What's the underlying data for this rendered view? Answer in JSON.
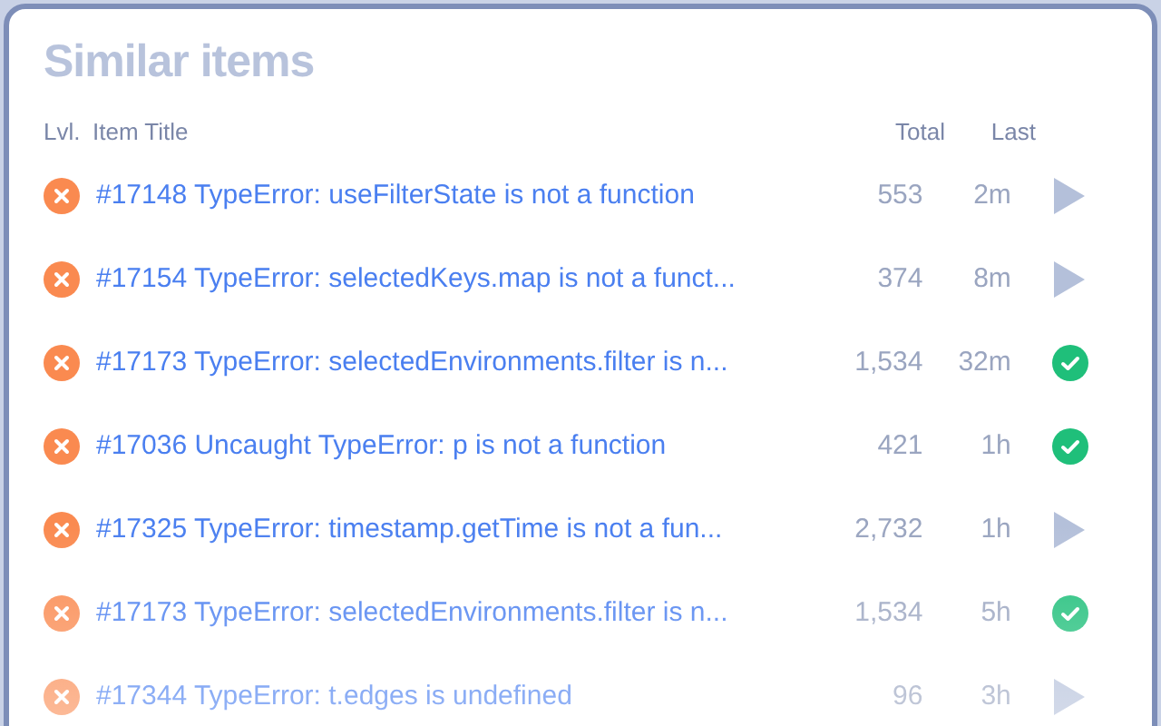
{
  "title": "Similar items",
  "columns": [
    "Lvl.",
    "Item Title",
    "Total",
    "Last"
  ],
  "rows": [
    {
      "title": "#17148 TypeError: useFilterState is not a function",
      "total": "553",
      "last": "2m",
      "resolved": false
    },
    {
      "title": "#17154 TypeError: selectedKeys.map is not a funct...",
      "total": "374",
      "last": "8m",
      "resolved": false
    },
    {
      "title": "#17173 TypeError: selectedEnvironments.filter is n...",
      "total": "1,534",
      "last": "32m",
      "resolved": true
    },
    {
      "title": "#17036 Uncaught TypeError: p is not a function",
      "total": "421",
      "last": "1h",
      "resolved": true
    },
    {
      "title": "#17325 TypeError: timestamp.getTime is not a fun...",
      "total": "2,732",
      "last": "1h",
      "resolved": false
    },
    {
      "title": "#17173 TypeError: selectedEnvironments.filter is n...",
      "total": "1,534",
      "last": "5h",
      "resolved": true
    },
    {
      "title": "#17344 TypeError: t.edges is undefined",
      "total": "96",
      "last": "3h",
      "resolved": false
    }
  ]
}
